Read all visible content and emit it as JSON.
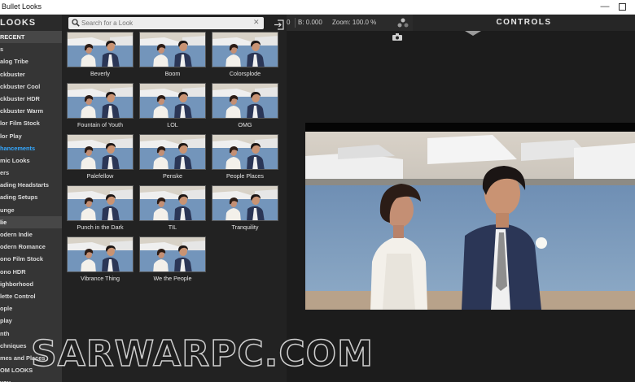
{
  "window": {
    "title": "Bullet Looks"
  },
  "sidebar": {
    "header": "LOOKS",
    "items": [
      {
        "label": "RECENT",
        "style": "group"
      },
      {
        "label": "s",
        "style": "normal"
      },
      {
        "label": "alog Tribe",
        "style": "normal"
      },
      {
        "label": "ckbuster",
        "style": "normal"
      },
      {
        "label": "ckbuster Cool",
        "style": "normal"
      },
      {
        "label": "ckbuster HDR",
        "style": "normal"
      },
      {
        "label": "ckbuster Warm",
        "style": "normal"
      },
      {
        "label": "lor Film Stock",
        "style": "normal"
      },
      {
        "label": "lor Play",
        "style": "normal"
      },
      {
        "label": "hancements",
        "style": "active"
      },
      {
        "label": "mic Looks",
        "style": "normal"
      },
      {
        "label": "ers",
        "style": "normal"
      },
      {
        "label": "ading Headstarts",
        "style": "normal"
      },
      {
        "label": "ading Setups",
        "style": "normal"
      },
      {
        "label": "unge",
        "style": "normal"
      },
      {
        "label": "lie",
        "style": "group"
      },
      {
        "label": "odern Indie",
        "style": "normal"
      },
      {
        "label": "odern Romance",
        "style": "normal"
      },
      {
        "label": "ono Film Stock",
        "style": "normal"
      },
      {
        "label": "ono HDR",
        "style": "normal"
      },
      {
        "label": "ighborhood",
        "style": "normal"
      },
      {
        "label": "lette Control",
        "style": "normal"
      },
      {
        "label": "ople",
        "style": "normal"
      },
      {
        "label": "play",
        "style": "normal"
      },
      {
        "label": "nth",
        "style": "normal"
      },
      {
        "label": "chniques",
        "style": "normal"
      },
      {
        "label": "mes and Places",
        "style": "normal"
      },
      {
        "label": "OM LOOKS",
        "style": "normal"
      },
      {
        "label": "you",
        "style": "normal"
      }
    ]
  },
  "search": {
    "placeholder": "Search for a Look",
    "value": ""
  },
  "looks": [
    "Beverly",
    "Boom",
    "Colorsplode",
    "Fountain of Youth",
    "LOL",
    "OMG",
    "Palefellow",
    "Penske",
    "People Places",
    "Punch in the Dark",
    "TIL",
    "Tranquility",
    "Vibrance Thing",
    "We the People"
  ],
  "toolbar": {
    "b_left": "0",
    "b_value": "B: 0.000",
    "zoom": "Zoom: 100.0 %"
  },
  "controls": {
    "title": "CONTROLS"
  },
  "watermark": "SARWARPC.COM",
  "colors": {
    "accent": "#34a8ff",
    "sidebar_bg": "#353535",
    "browser_bg": "#222222"
  }
}
